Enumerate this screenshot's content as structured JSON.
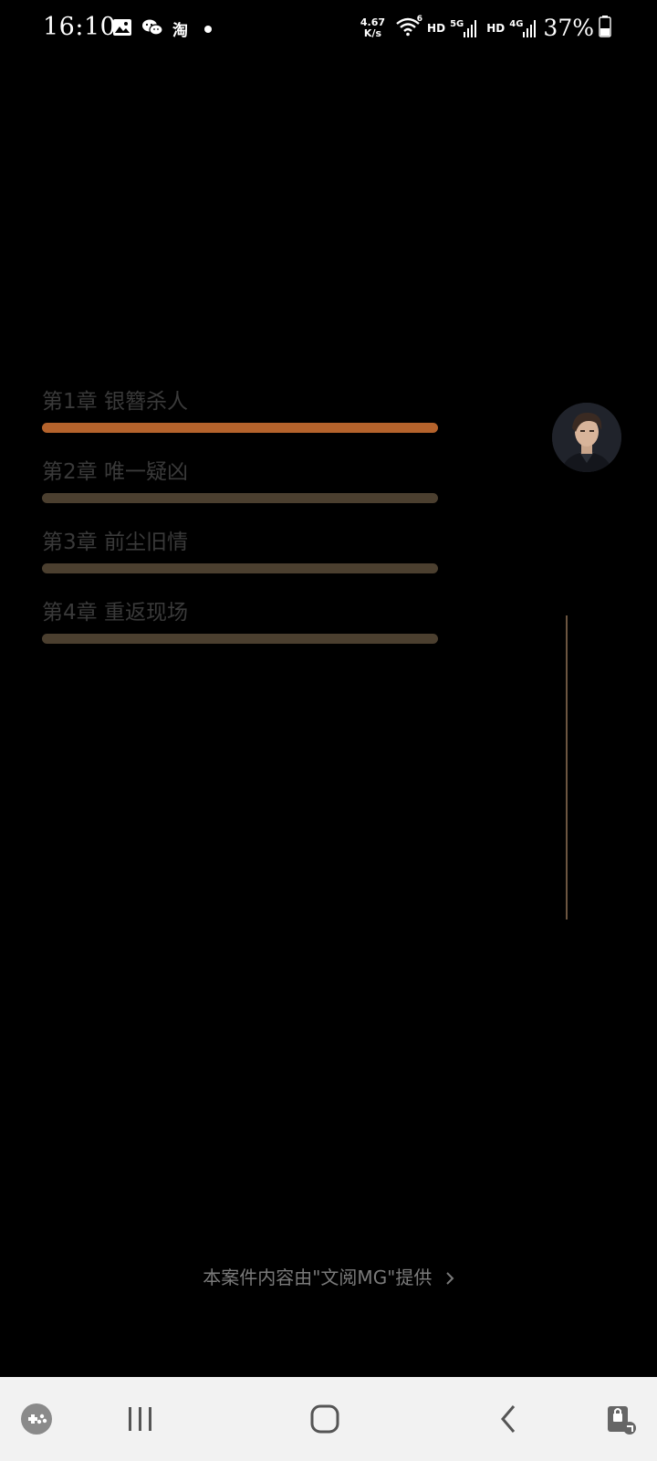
{
  "status_bar": {
    "time": "16:10",
    "net_speed_value": "4.67",
    "net_speed_unit": "K/s",
    "wifi_badge": "6",
    "hd1": "HD",
    "signal1_type": "5G",
    "hd2": "HD",
    "signal2_type": "4G",
    "battery": "37%",
    "left_icons": [
      "image-icon",
      "wechat-icon",
      "taobao-icon",
      "dot-icon"
    ],
    "taobao_glyph": "淘"
  },
  "chapters": [
    {
      "title": "第1章 银簪杀人",
      "active": true
    },
    {
      "title": "第2章 唯一疑凶",
      "active": false
    },
    {
      "title": "第3章 前尘旧情",
      "active": false
    },
    {
      "title": "第4章 重返现场",
      "active": false
    }
  ],
  "credit": {
    "text": "本案件内容由\"文阅MG\"提供"
  },
  "nav_bar": {
    "icons": [
      "game-launcher-icon",
      "recent-apps-icon",
      "home-icon",
      "back-icon",
      "screen-lock-icon"
    ]
  },
  "colors": {
    "background": "#000000",
    "active_bar": "#b5632c",
    "inactive_bar": "#4b3f2f",
    "chapter_text": "#3a3a3a",
    "nav_bg": "#f2f2f2"
  }
}
